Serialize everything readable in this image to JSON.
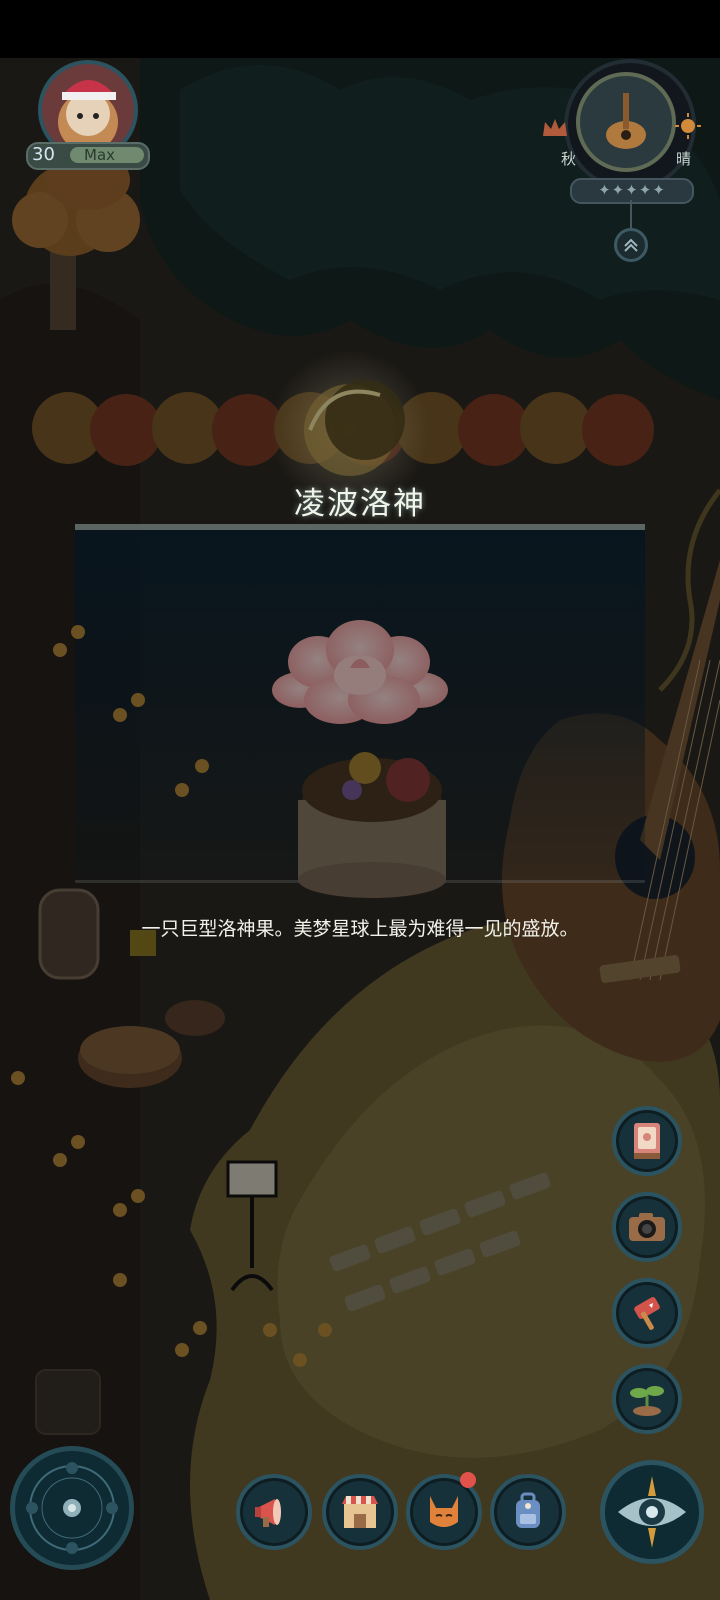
{
  "player": {
    "level": "30",
    "level_status": "Max"
  },
  "weather": {
    "season": "秋",
    "condition": "晴",
    "stars": "✦✦✦✦✦"
  },
  "item": {
    "name": "凌波洛神",
    "description": "一只巨型洛神果。美梦星球上最为难得一见的盛放。"
  },
  "side_buttons": [
    {
      "name": "journal-button",
      "icon": "book-icon"
    },
    {
      "name": "camera-button",
      "icon": "camera-icon"
    },
    {
      "name": "hammer-button",
      "icon": "hammer-icon"
    },
    {
      "name": "sprout-button",
      "icon": "sprout-icon"
    }
  ],
  "bottom_buttons": [
    {
      "name": "announcement-button",
      "icon": "megaphone-icon"
    },
    {
      "name": "shop-button",
      "icon": "shop-icon"
    },
    {
      "name": "pet-button",
      "icon": "fox-icon"
    },
    {
      "name": "backpack-button",
      "icon": "backpack-icon"
    }
  ],
  "colors": {
    "panel": "#17313a",
    "gold": "#e8c983",
    "petal": "#f6b2b0",
    "lake": "#d7c37a"
  }
}
